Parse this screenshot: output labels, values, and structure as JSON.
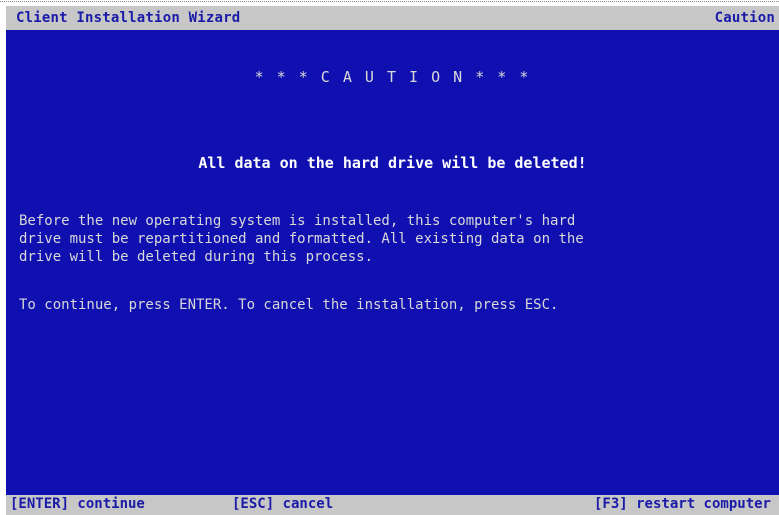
{
  "header": {
    "title": "Client Installation Wizard",
    "right_label": "Caution"
  },
  "main": {
    "heading": "* * * C A U T I O N * * *",
    "warning": "All data on the hard drive will be deleted!",
    "description_lines": [
      "Before the new operating system is installed, this computer's hard",
      "drive must be repartitioned and formatted. All existing data on the",
      "drive will be deleted during this process."
    ],
    "instruction": "To continue, press ENTER. To cancel the installation, press ESC."
  },
  "footer": {
    "enter_label": "[ENTER] continue",
    "esc_label": "[ESC] cancel",
    "f3_label": "[F3] restart computer"
  },
  "colors": {
    "background": "#1010b0",
    "bar": "#c7c7c7",
    "bar_text": "#1a1aa8",
    "body_text": "#d8d8d8",
    "warning_text": "#ffffff"
  }
}
